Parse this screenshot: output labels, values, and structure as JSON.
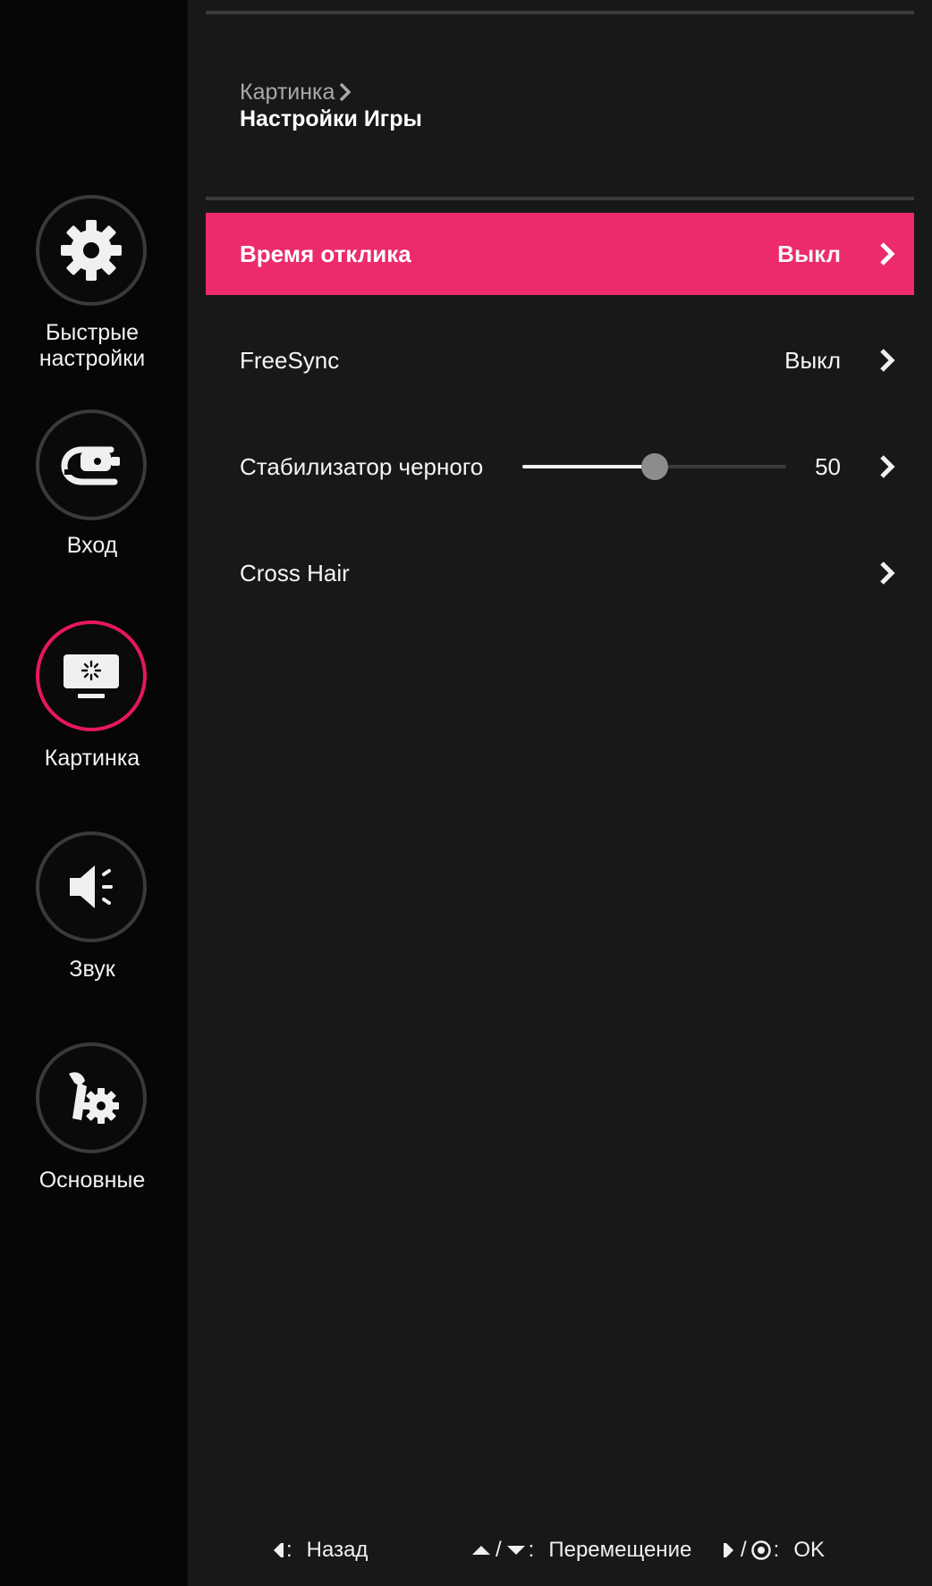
{
  "sidebar": {
    "items": [
      {
        "id": "quick",
        "label": "Быстрые\nнастройки",
        "icon": "gear-icon",
        "active": false
      },
      {
        "id": "input",
        "label": "Вход",
        "icon": "input-cable-icon",
        "active": false
      },
      {
        "id": "picture",
        "label": "Картинка",
        "icon": "monitor-icon",
        "active": true
      },
      {
        "id": "sound",
        "label": "Звук",
        "icon": "speaker-icon",
        "active": false
      },
      {
        "id": "general",
        "label": "Основные",
        "icon": "tools-icon",
        "active": false
      }
    ]
  },
  "breadcrumb": {
    "parent": "Картинка",
    "current": "Настройки Игры"
  },
  "settings": [
    {
      "label": "Время отклика",
      "value": "Выкл",
      "selected": true
    },
    {
      "label": "FreeSync",
      "value": "Выкл",
      "selected": false
    },
    {
      "label": "Стабилизатор черного",
      "value": "50",
      "slider": 0.5,
      "selected": false
    },
    {
      "label": "Cross Hair",
      "value": "",
      "selected": false
    }
  ],
  "footer": {
    "back_separator": ":",
    "back_label": "Назад",
    "move_separator": "/",
    "move_colon": ":",
    "move_label": "Перемещение",
    "ok_separator": "/",
    "ok_colon": ":",
    "ok_label": "OK"
  },
  "colors": {
    "accent": "#e6185b",
    "selected_row": "#ec2a6c",
    "background": "#181818",
    "sidebar": "#060606"
  }
}
